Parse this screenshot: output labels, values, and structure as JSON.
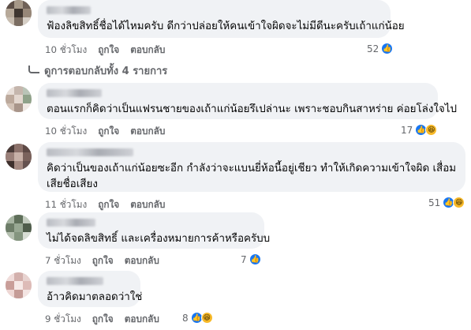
{
  "comments": [
    {
      "text": "ฟ้องลิขสิทธิ์ชื่อได้ไหมครับ ดีกว่าปล่อยให้คนเข้าใจผิดจะไม่มีดีนะครับเถ้าแก่น้อย",
      "time": "10 ชั่วโมง",
      "like": "ถูกใจ",
      "reply": "ตอบกลับ",
      "reaction_count": "52",
      "reactions": [
        "like-icon"
      ]
    },
    {
      "text": "ตอนแรกก็คิดว่าเป็นแฟรนชายของเถ้าแก่น้อยรึเปล่านะ เพราะชอบกินสาหร่าย ค่อยโล่งใจไป",
      "time": "10 ชั่วโมง",
      "like": "ถูกใจ",
      "reply": "ตอบกลับ",
      "reaction_count": "17",
      "reactions": [
        "like-icon",
        "haha-icon"
      ]
    },
    {
      "text": "คิดว่าเป็นของเถ้าแก่น้อยซะอีก กำลังว่าจะแบนยี่ห้อนี้อยู่เชียว ทำให้เกิดความเข้าใจผิด เสื่อมเสียชื่อเสียง",
      "time": "11 ชั่วโมง",
      "like": "ถูกใจ",
      "reply": "ตอบกลับ",
      "reaction_count": "51",
      "reactions": [
        "like-icon",
        "haha-icon"
      ]
    },
    {
      "text": "ไม่ได้จดลิขสิทธิ์ และเครื่องหมายการค้าหรือครับบ",
      "time": "7 ชั่วโมง",
      "like": "ถูกใจ",
      "reply": "ตอบกลับ",
      "reaction_count": "7",
      "reactions": [
        "like-icon"
      ]
    },
    {
      "text": "อ้าวคิดมาตลอดว่าใช่",
      "time": "9 ชั่วโมง",
      "like": "ถูกใจ",
      "reply": "ตอบกลับ",
      "reaction_count": "8",
      "reactions": [
        "like-icon",
        "haha-icon"
      ]
    }
  ],
  "view_replies": "ดูการตอบกลับทั้ง 4 รายการ",
  "colors": {
    "bubble": "#f0f2f5",
    "meta": "#65676b",
    "like": "#1877f2",
    "haha": "#f7b928"
  }
}
